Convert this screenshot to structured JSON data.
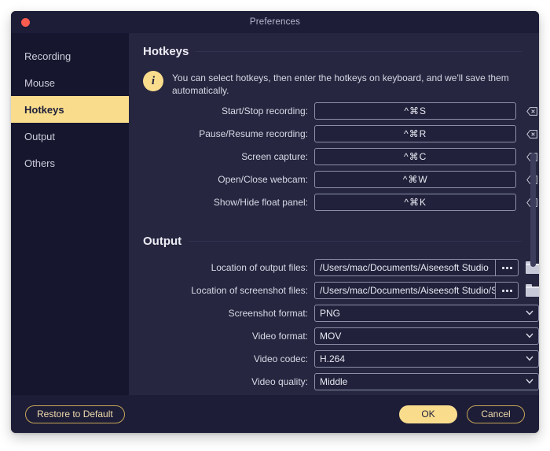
{
  "window": {
    "title": "Preferences",
    "close_icon": "close-dot"
  },
  "sidebar": {
    "items": [
      {
        "label": "Recording",
        "active": false
      },
      {
        "label": "Mouse",
        "active": false
      },
      {
        "label": "Hotkeys",
        "active": true
      },
      {
        "label": "Output",
        "active": false
      },
      {
        "label": "Others",
        "active": false
      }
    ]
  },
  "hotkeys_section": {
    "title": "Hotkeys",
    "info_icon": "info-icon",
    "info_text": "You can select hotkeys, then enter the hotkeys on keyboard, and we'll save them automatically.",
    "clear_icon": "backspace-icon",
    "rows": [
      {
        "label": "Start/Stop recording:",
        "value": "^⌘S"
      },
      {
        "label": "Pause/Resume recording:",
        "value": "^⌘R"
      },
      {
        "label": "Screen capture:",
        "value": "^⌘C"
      },
      {
        "label": "Open/Close webcam:",
        "value": "^⌘W"
      },
      {
        "label": "Show/Hide float panel:",
        "value": "^⌘K"
      }
    ]
  },
  "output_section": {
    "title": "Output",
    "browse_icon": "ellipsis-icon",
    "folder_icon": "folder-icon",
    "chevron_icon": "chevron-down-icon",
    "paths": [
      {
        "label": "Location of output files:",
        "value": "/Users/mac/Documents/Aiseesoft Studio"
      },
      {
        "label": "Location of screenshot files:",
        "value": "/Users/mac/Documents/Aiseesoft Studio/Snapshot"
      }
    ],
    "selects": [
      {
        "label": "Screenshot format:",
        "value": "PNG"
      },
      {
        "label": "Video format:",
        "value": "MOV"
      },
      {
        "label": "Video codec:",
        "value": "H.264"
      },
      {
        "label": "Video quality:",
        "value": "Middle"
      }
    ]
  },
  "footer": {
    "restore_label": "Restore to Default",
    "ok_label": "OK",
    "cancel_label": "Cancel"
  },
  "colors": {
    "accent": "#f9dd8d",
    "sidebar_bg": "#16162e",
    "content_bg": "#262640",
    "chrome_bg": "#1d1d38",
    "close_dot": "#fb5c50"
  }
}
